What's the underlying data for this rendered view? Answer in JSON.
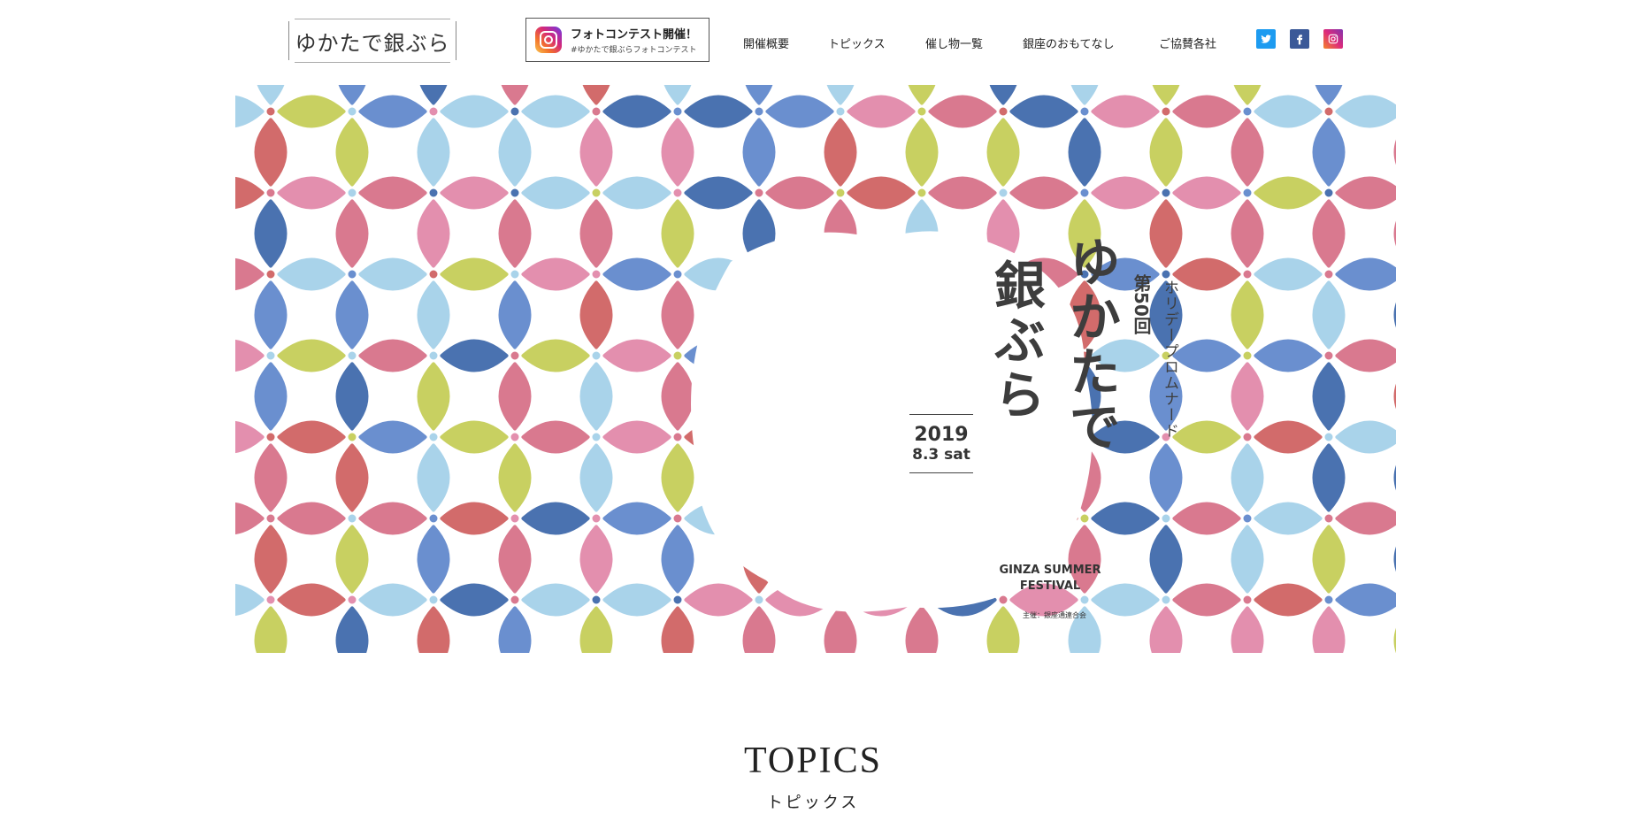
{
  "header": {
    "logo_text": "ゆかたで銀ぶら",
    "photo_contest": {
      "title": "フォトコンテスト開催！",
      "subtitle": "#ゆかたで銀ぶらフォトコンテスト"
    },
    "nav": [
      {
        "label": "開催概要"
      },
      {
        "label": "トピックス"
      },
      {
        "label": "催し物一覧"
      },
      {
        "label": "銀座のおもてなし"
      },
      {
        "label": "ご協賛各社"
      }
    ],
    "social": [
      "twitter-icon",
      "facebook-icon",
      "instagram-icon"
    ]
  },
  "hero": {
    "title_line1": "ゆかたで",
    "title_line2": "銀ぶら",
    "edition": "第50回",
    "event": "ホリデープロムナード",
    "date_year": "2019",
    "date_day": "8.3 sat",
    "english_title_line1": "GINZA SUMMER",
    "english_title_line2": "FESTIVAL",
    "organizer": "主催：銀座通連合会",
    "pattern_colors": [
      "#d9798f",
      "#4a72b0",
      "#c8d061",
      "#a9d3ea",
      "#d26b6b",
      "#e38fae",
      "#6a8fcf"
    ]
  },
  "topics": {
    "title": "TOPICS",
    "subtitle": "トピックス"
  }
}
